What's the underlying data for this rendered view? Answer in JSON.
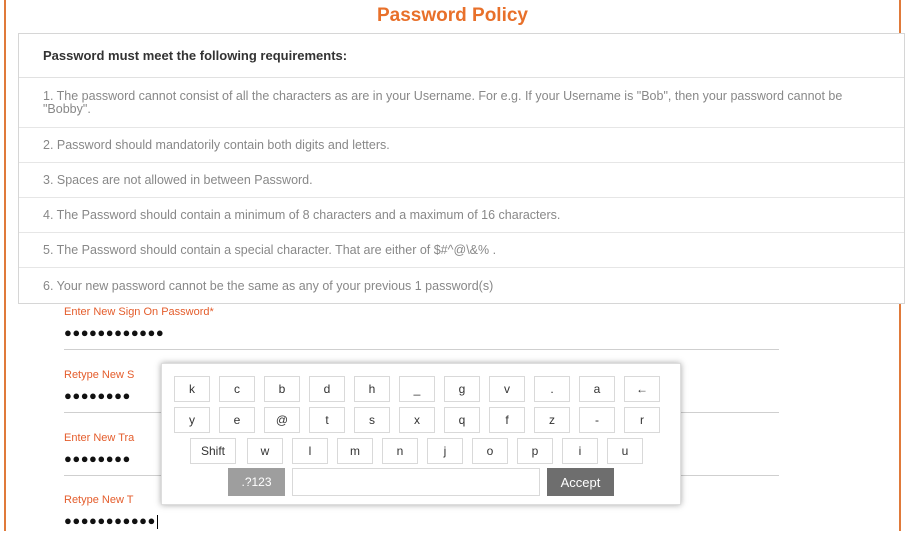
{
  "title": "Password Policy",
  "policy": {
    "heading": "Password must meet the following requirements:",
    "rules": [
      "1. The password cannot consist of all the characters as are in your Username. For e.g. If your Username is \"Bob\", then your password cannot be \"Bobby\".",
      "2. Password should mandatorily contain both digits and letters.",
      "3. Spaces are not allowed in between Password.",
      "4. The Password should contain a minimum of 8 characters and a maximum of 16 characters.",
      "5. The Password should contain a special character. That are either of $#^@\\&% .",
      "6. Your new password cannot be the same as any of your previous 1 password(s)"
    ]
  },
  "fields": {
    "new_signon_label": "Enter New Sign On Password*",
    "new_signon_value": "●●●●●●●●●●●●",
    "retype_signon_label": "Retype New S",
    "retype_signon_value": "●●●●●●●●",
    "new_trans_label": "Enter New Tra",
    "new_trans_value": "●●●●●●●●",
    "retype_trans_label": "Retype New T",
    "retype_trans_value": "●●●●●●●●●●●"
  },
  "keyboard": {
    "row1": [
      "k",
      "c",
      "b",
      "d",
      "h",
      "_",
      "g",
      "v",
      ".",
      "a",
      "←"
    ],
    "row2": [
      "y",
      "e",
      "@",
      "t",
      "s",
      "x",
      "q",
      "f",
      "z",
      "-",
      "r"
    ],
    "row3": [
      "Shift",
      "w",
      "l",
      "m",
      "n",
      "j",
      "o",
      "p",
      "i",
      "u"
    ],
    "num_label": ".?123",
    "accept_label": "Accept"
  }
}
